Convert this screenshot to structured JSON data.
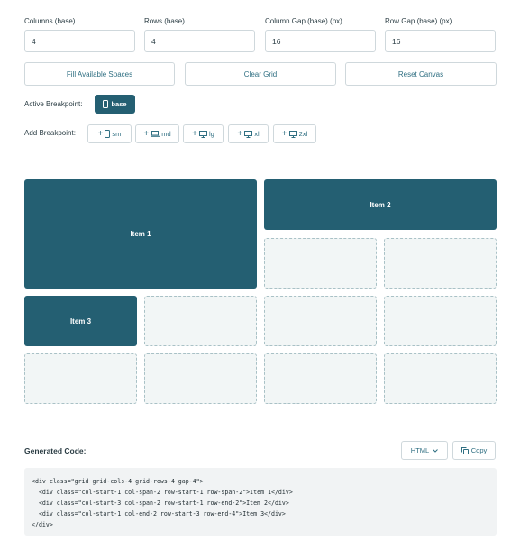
{
  "settings": {
    "columns_label": "Columns (base)",
    "columns_value": "4",
    "rows_label": "Rows (base)",
    "rows_value": "4",
    "col_gap_label": "Column Gap (base) (px)",
    "col_gap_value": "16",
    "row_gap_label": "Row Gap (base) (px)",
    "row_gap_value": "16"
  },
  "actions": {
    "fill": "Fill Available Spaces",
    "clear": "Clear Grid",
    "reset": "Reset Canvas"
  },
  "breakpoints": {
    "active_label": "Active Breakpoint:",
    "active_value": "base",
    "add_label": "Add Breakpoint:",
    "options": [
      "sm",
      "md",
      "lg",
      "xl",
      "2xl"
    ]
  },
  "grid": {
    "items": [
      "Item 1",
      "Item 2",
      "Item 3"
    ]
  },
  "code": {
    "title": "Generated Code:",
    "language": "HTML",
    "copy_label": "Copy",
    "lines": [
      "<div class=\"grid grid-cols-4 grid-rows-4 gap-4\">",
      "  <div class=\"col-start-1 col-span-2 row-start-1 row-span-2\">Item 1</div>",
      "  <div class=\"col-start-3 col-span-2 row-start-1 row-end-2\">Item 2</div>",
      "  <div class=\"col-start-1 col-end-2 row-start-3 row-end-4\">Item 3</div>",
      "</div>"
    ]
  },
  "colors": {
    "accent": "#245f72",
    "cell_bg": "#f2f6f6",
    "cell_border": "#a9c1c6"
  }
}
